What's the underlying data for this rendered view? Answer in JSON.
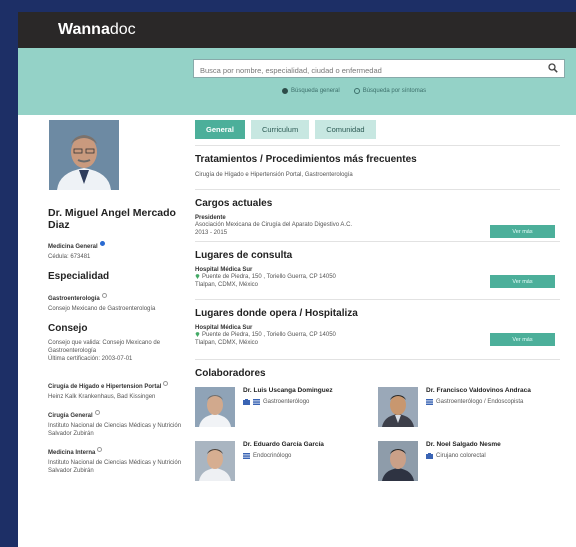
{
  "brand": {
    "part1": "Wanna",
    "part2": "doc"
  },
  "search": {
    "placeholder": "Busca por nombre, especialidad, ciudad o enfermedad",
    "mode1": "Búsqueda general",
    "mode2": "Búsqueda por síntomas"
  },
  "doctor": {
    "name": "Dr. Miguel Angel Mercado Diaz",
    "tag": "Medicina General",
    "cedula": "Cédula: 673481"
  },
  "especialidad": {
    "title": "Especialidad",
    "item": "Gastroenterología",
    "detail": "Consejo Mexicano de Gastroenterología"
  },
  "consejo": {
    "title": "Consejo",
    "line1": "Consejo que valida: Consejo Mexicano de Gastroenterología",
    "line2": "Última certificación: 2003-07-01"
  },
  "training": [
    {
      "title": "Cirugía de Hígado e Hipertension Portal",
      "place": "Heinz Kalk Krankenhaus, Bad Kissingen"
    },
    {
      "title": "Cirugía General",
      "place": "Instituto Nacional de Ciencias Médicas y Nutrición Salvador Zubirán"
    },
    {
      "title": "Medicina Interna",
      "place": "Instituto Nacional de Ciencias Médicas y Nutrición Salvador Zubirán"
    }
  ],
  "tabs": [
    "General",
    "Curriculum",
    "Comunidad"
  ],
  "tratamientos": {
    "title": "Tratamientos / Procedimientos más frecuentes",
    "text": "Cirugía de Hígado e Hipertensión Portal, Gastroenterología"
  },
  "cargos": {
    "title": "Cargos actuales",
    "role": "Presidente",
    "org": "Asociación Mexicana de Cirugía del Aparato Digestivo A.C.",
    "years": "2013 - 2015",
    "btn": "Ver más"
  },
  "consulta": {
    "title": "Lugares de consulta",
    "place": "Hospital Médica Sur",
    "addr1": "Puente de Piedra, 150 , Toriello Guerra, CP 14050",
    "addr2": "Tlalpan, CDMX, México",
    "btn": "Ver más"
  },
  "opera": {
    "title": "Lugares donde opera / Hospitaliza",
    "place": "Hospital Médica Sur",
    "addr1": "Puente de Piedra, 150 , Toriello Guerra, CP 14050",
    "addr2": "Tlalpan, CDMX, México",
    "btn": "Ver más"
  },
  "colaboradores": {
    "title": "Colaboradores",
    "items": [
      {
        "name": "Dr. Luis Uscanga Dominguez",
        "spec": "Gastroenterólogo"
      },
      {
        "name": "Dr. Francisco Valdovinos Andraca",
        "spec": "Gastroenterólogo / Endoscopista"
      },
      {
        "name": "Dr. Eduardo García García",
        "spec": "Endocrinólogo"
      },
      {
        "name": "Dr. Noel Salgado Nesme",
        "spec": "Cirujano colorectal"
      }
    ]
  },
  "colors": {
    "accent": "#4caf9a",
    "topbar": "#2a2828",
    "searchband": "#94d2c7",
    "background": "#1d2f66"
  }
}
